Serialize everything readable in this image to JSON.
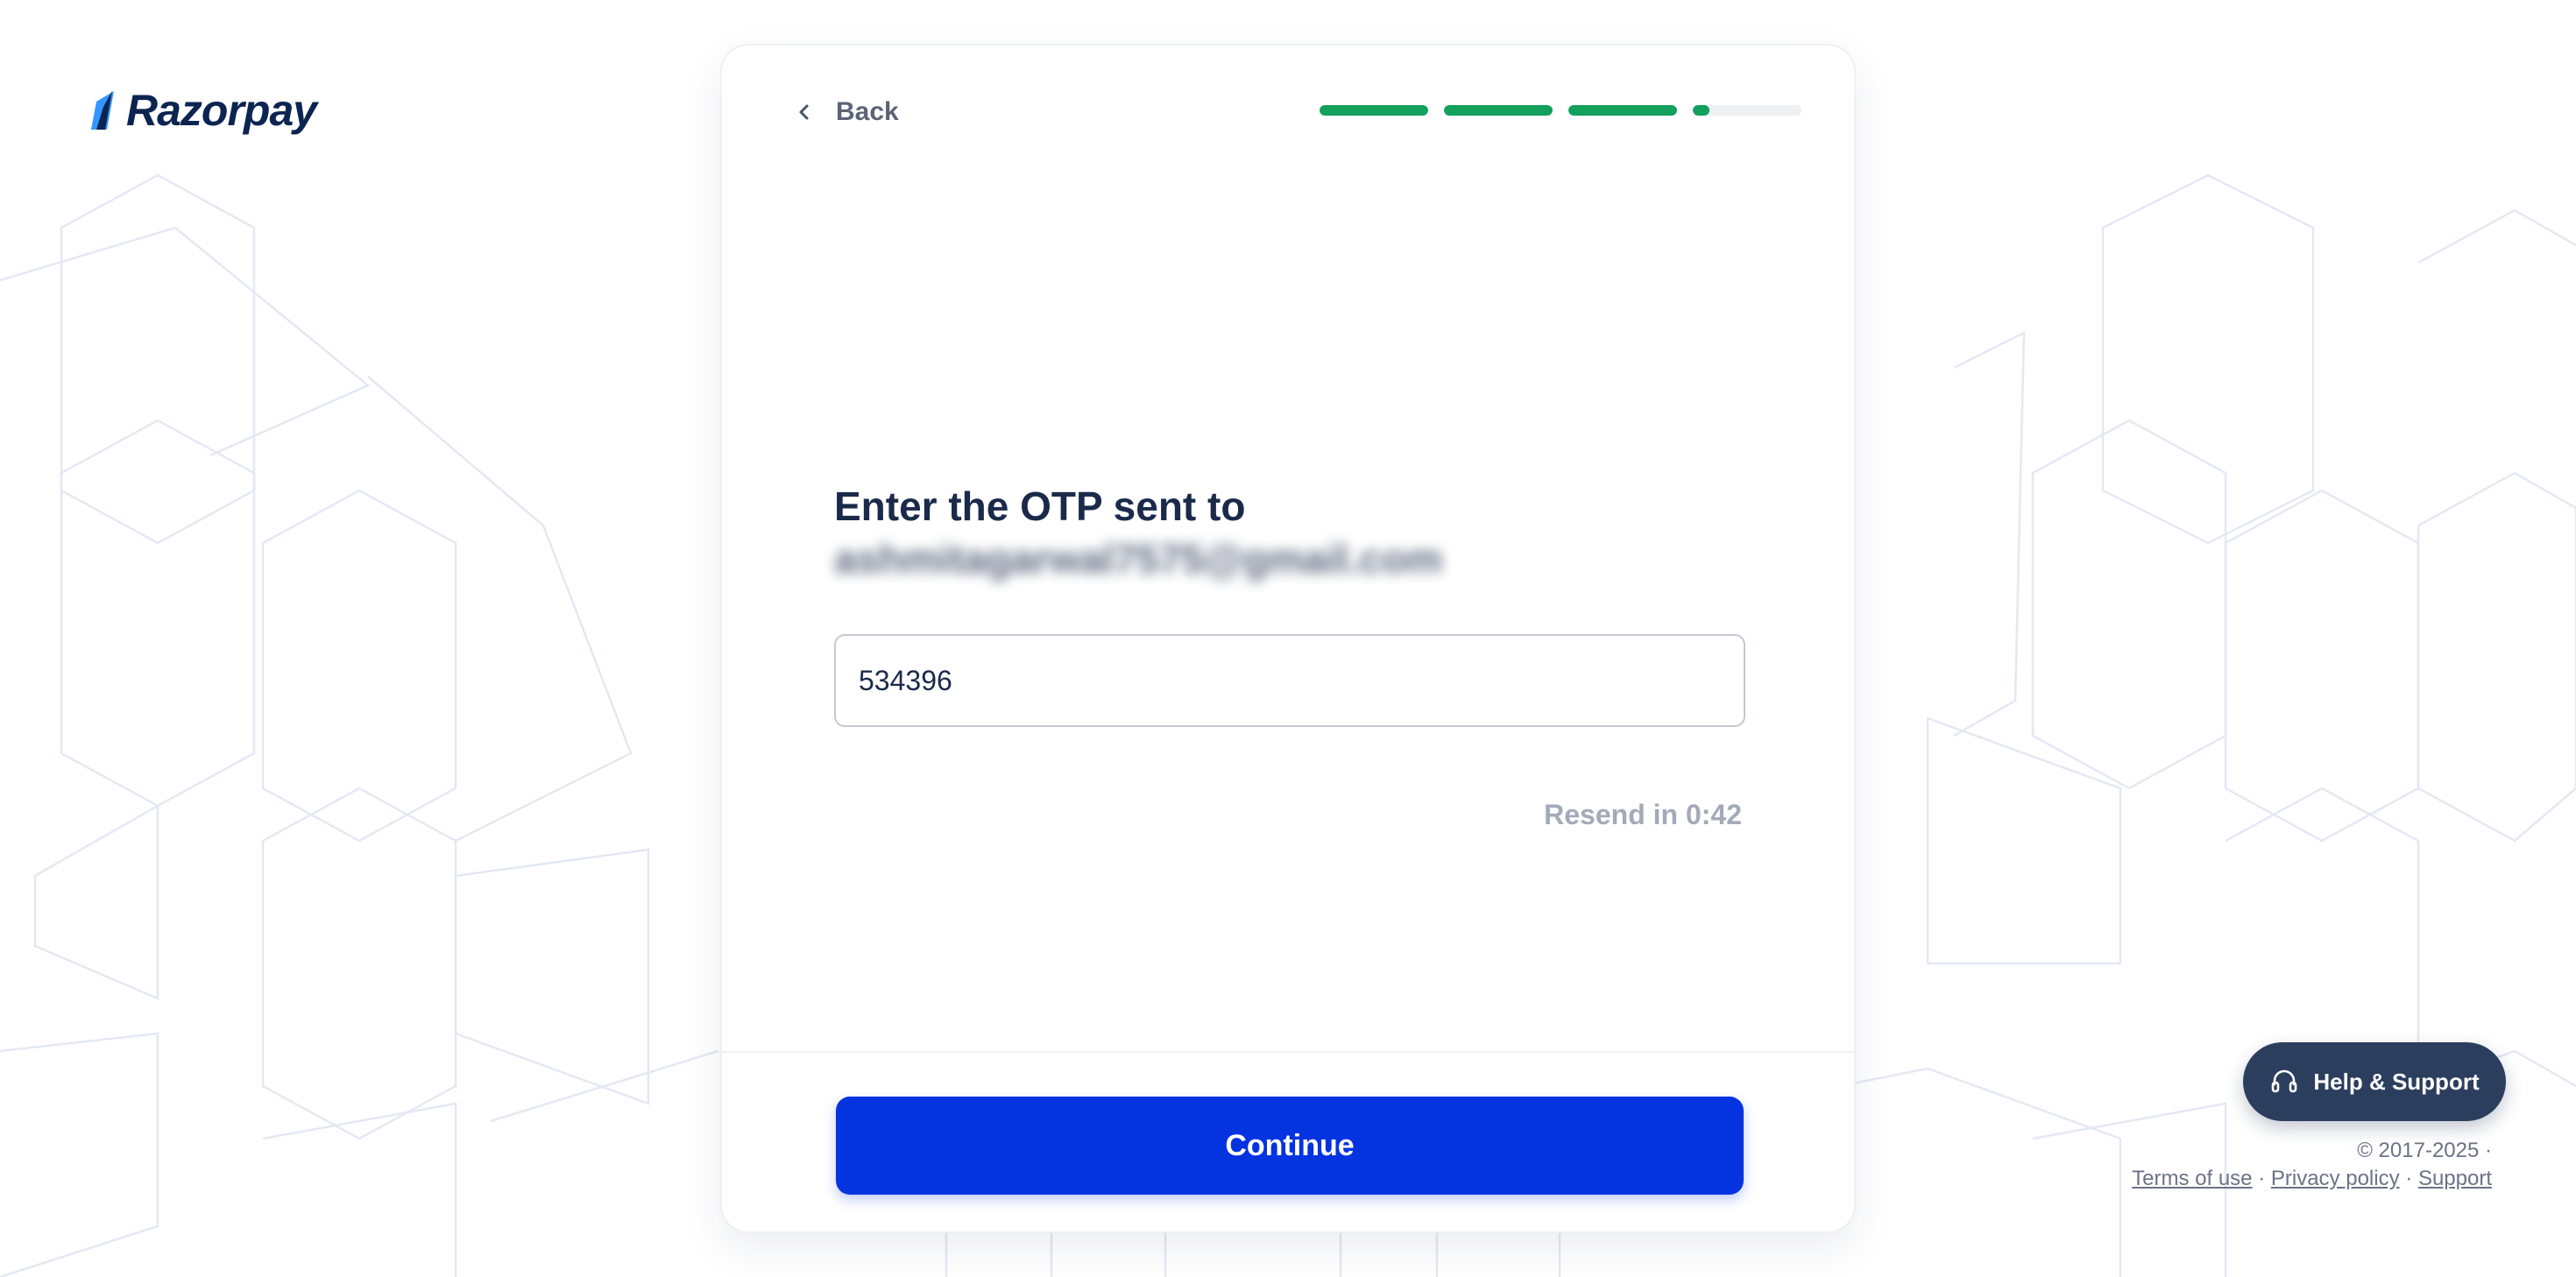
{
  "brand": {
    "name": "Razorpay",
    "color": "#0c2451",
    "accent": "#3395ff"
  },
  "header": {
    "back_label": "Back",
    "progress": {
      "steps_total": 4,
      "steps_complete": 3,
      "current_step_fraction": 0.15,
      "color": "#12a05c"
    }
  },
  "main": {
    "title": "Enter the OTP sent to",
    "email": "ashmitagarwal7575@gmail.com",
    "otp_value": "534396",
    "resend_text": "Resend in 0:42"
  },
  "actions": {
    "continue_label": "Continue",
    "continue_color": "#0433e0"
  },
  "support": {
    "help_label": "Help & Support"
  },
  "footer": {
    "copyright": "© 2017-2025 ·",
    "terms": "Terms of use",
    "privacy": "Privacy policy",
    "support": "Support",
    "separator": "·"
  },
  "icons": {
    "back": "chevron-left-icon",
    "help": "headset-icon",
    "logo": "razorpay-logo-mark"
  }
}
